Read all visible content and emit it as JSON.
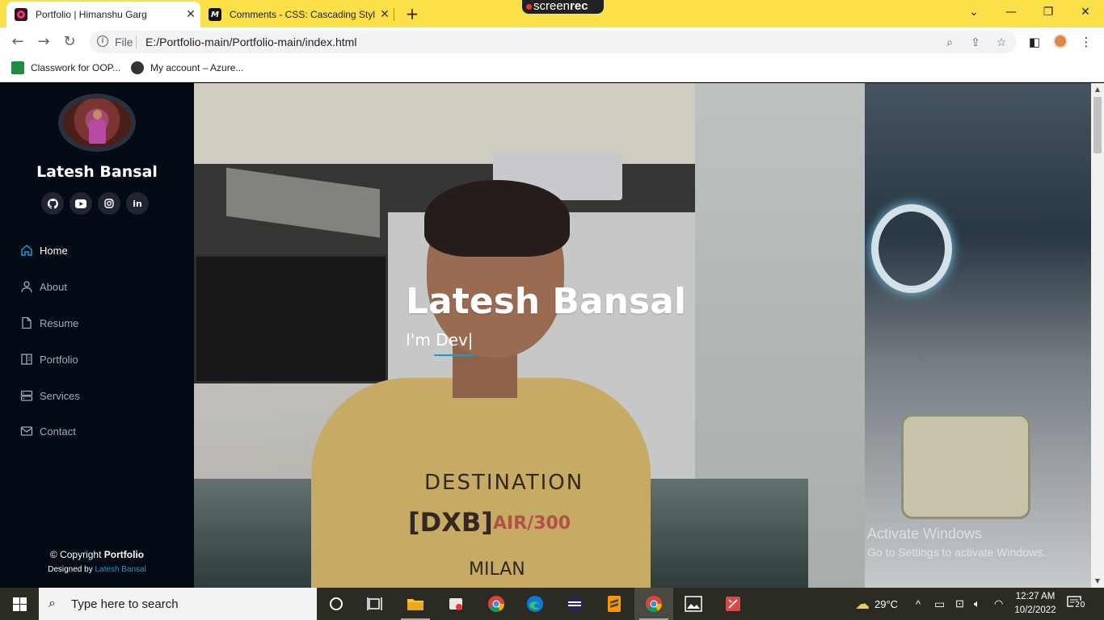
{
  "browser": {
    "tabs": [
      {
        "title": "Portfolio | Himanshu Garg",
        "active": true,
        "favicon_color": "#c2185b"
      },
      {
        "title": "Comments - CSS: Cascading Style",
        "active": false,
        "favicon_color": "#111111"
      }
    ],
    "recorder_label": "screenrec",
    "recorder_label_a": "screen",
    "recorder_label_b": "rec",
    "url_scheme": "File",
    "url": "E:/Portfolio-main/Portfolio-main/index.html",
    "bookmarks": [
      {
        "label": "Classwork for OOP...",
        "icon_color": "#1e8e3e"
      },
      {
        "label": "My account – Azure...",
        "icon_color": "#333333"
      }
    ]
  },
  "sidebar": {
    "name": "Latesh Bansal",
    "socials": [
      "github-icon",
      "youtube-icon",
      "instagram-icon",
      "linkedin-icon"
    ],
    "nav": [
      {
        "label": "Home",
        "icon": "home-icon",
        "active": true
      },
      {
        "label": "About",
        "icon": "person-icon",
        "active": false
      },
      {
        "label": "Resume",
        "icon": "file-icon",
        "active": false
      },
      {
        "label": "Portfolio",
        "icon": "book-icon",
        "active": false
      },
      {
        "label": "Services",
        "icon": "server-icon",
        "active": false
      },
      {
        "label": "Contact",
        "icon": "envelope-icon",
        "active": false
      }
    ],
    "footer": {
      "copyright_prefix": "© Copyright",
      "copyright_strong": "Portfolio",
      "designed_prefix": "Designed by",
      "designed_link": "Latesh Bansal"
    }
  },
  "hero": {
    "title": "Latesh Bansal",
    "typed_prefix": "I'm",
    "typed_text": "Dev|",
    "shirt_lines": [
      "DESTINATION",
      "[DXB]",
      "AIR/300",
      "MILAN"
    ]
  },
  "watermark": {
    "line1": "Activate Windows",
    "line2": "Go to Settings to activate Windows."
  },
  "taskbar": {
    "search_placeholder": "Type here to search",
    "weather": "29°C",
    "time": "12:27 AM",
    "date": "10/2/2022",
    "notification_count": "20"
  },
  "colors": {
    "accent": "#149ddd",
    "sidebar_bg": "#040b14",
    "tabbar_bg": "#fbe04a"
  }
}
